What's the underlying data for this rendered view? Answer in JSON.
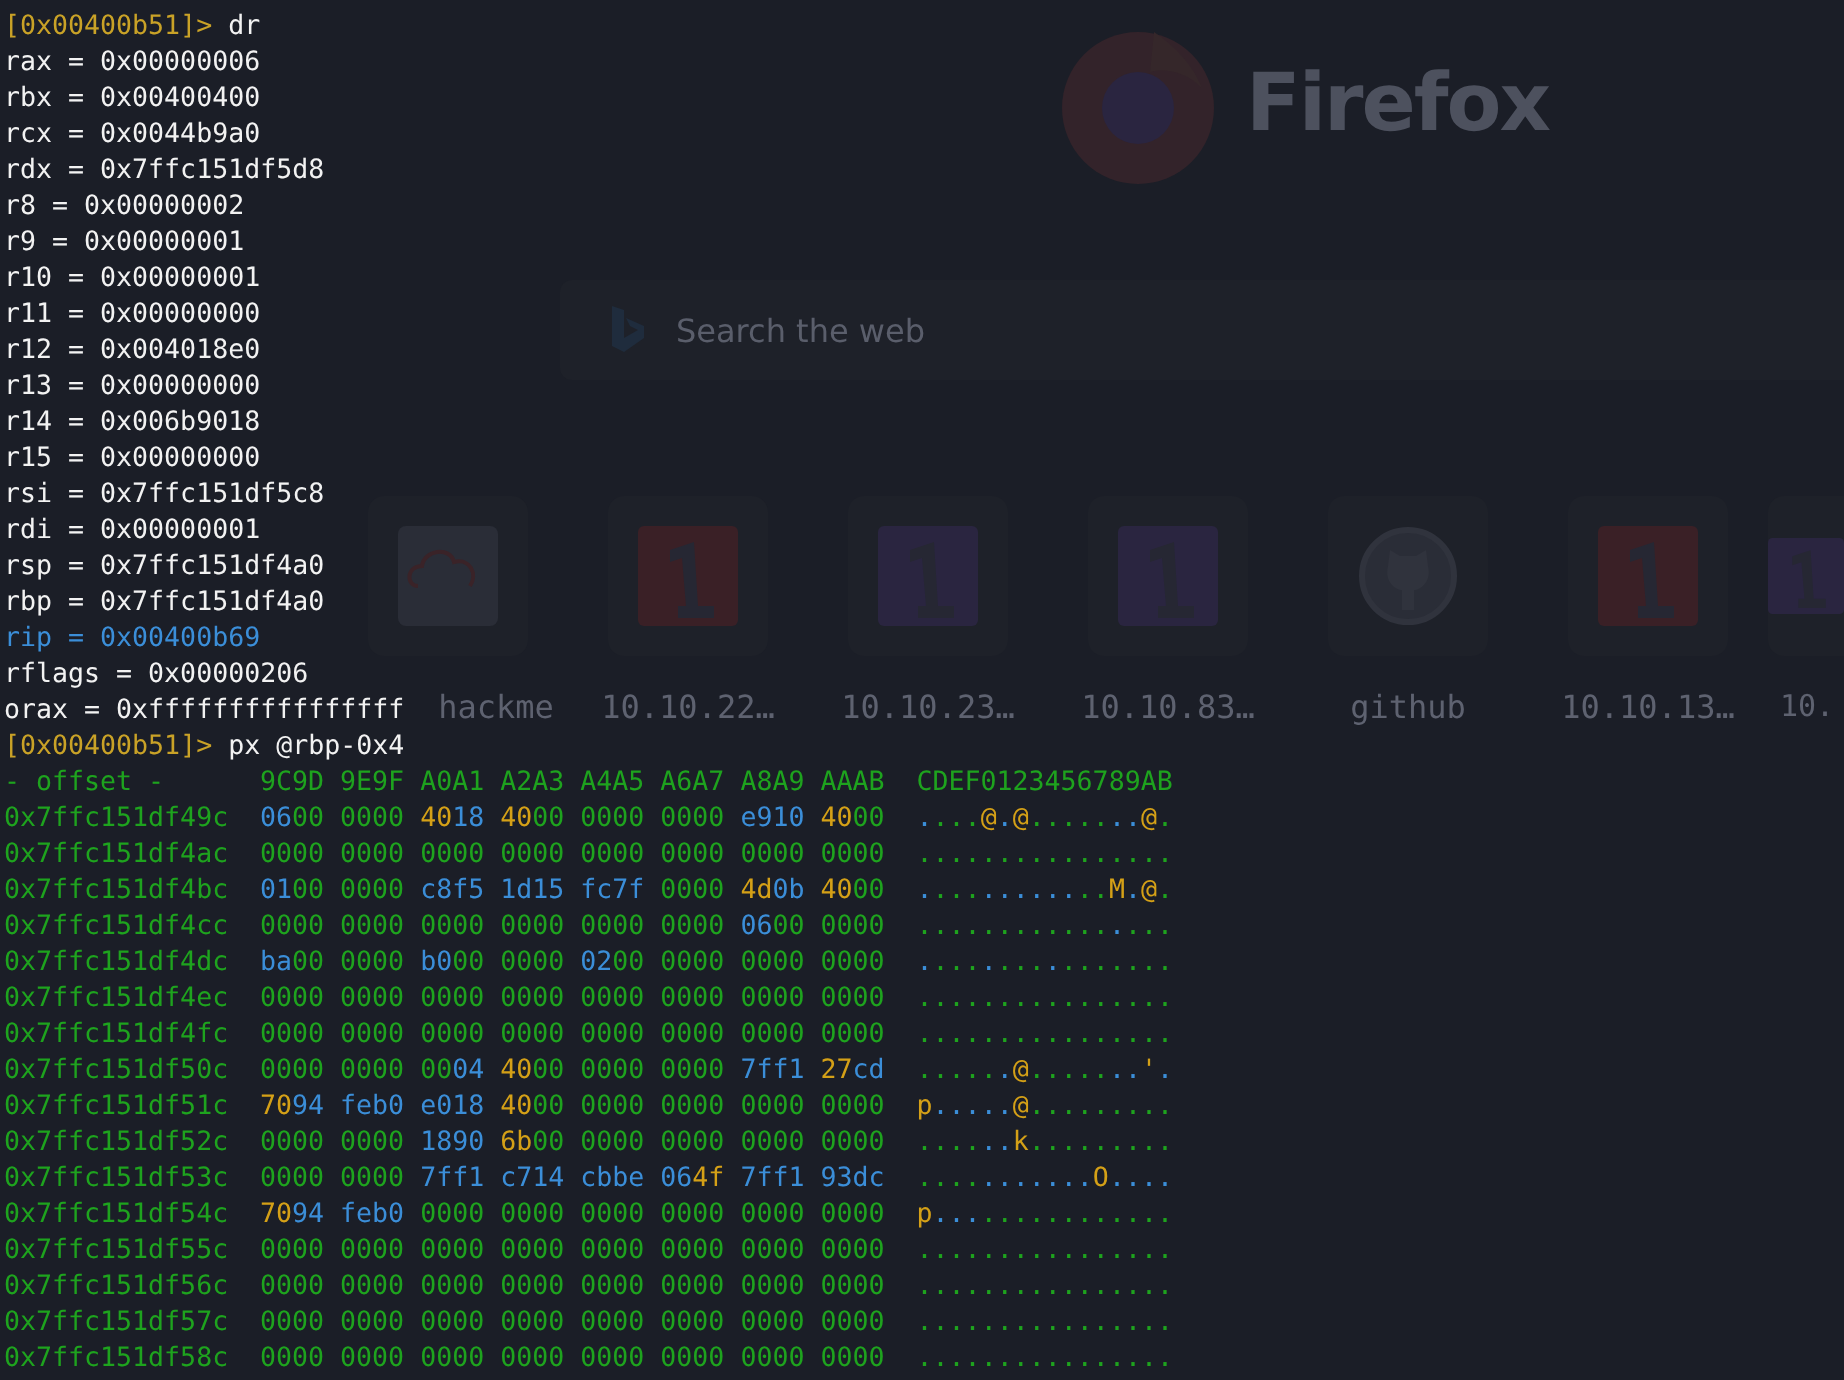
{
  "background_browser": {
    "brand": "Firefox",
    "search_placeholder": "Search the web",
    "shortcuts": [
      {
        "label": "hackme",
        "kind": "cloud",
        "color": "#2a2d37"
      },
      {
        "label": "10.10.22…",
        "kind": "numeral",
        "color": "#3a2026"
      },
      {
        "label": "10.10.23…",
        "kind": "numeral",
        "color": "#2a2540"
      },
      {
        "label": "10.10.83…",
        "kind": "numeral",
        "color": "#2a2540"
      },
      {
        "label": "github",
        "kind": "github",
        "color": "#2a2d37"
      },
      {
        "label": "10.10.13…",
        "kind": "numeral",
        "color": "#3a2026"
      },
      {
        "label": "10.",
        "kind": "numeral",
        "color": "#2a2540"
      }
    ]
  },
  "terminal": {
    "lines": [
      {
        "kind": "prompt",
        "address": "[0x00400b51]>",
        "command": "dr"
      },
      {
        "kind": "register",
        "text": "rax = 0x00000006",
        "changed": false
      },
      {
        "kind": "register",
        "text": "rbx = 0x00400400",
        "changed": false
      },
      {
        "kind": "register",
        "text": "rcx = 0x0044b9a0",
        "changed": false
      },
      {
        "kind": "register",
        "text": "rdx = 0x7ffc151df5d8",
        "changed": false
      },
      {
        "kind": "register",
        "text": "r8 = 0x00000002",
        "changed": false
      },
      {
        "kind": "register",
        "text": "r9 = 0x00000001",
        "changed": false
      },
      {
        "kind": "register",
        "text": "r10 = 0x00000001",
        "changed": false
      },
      {
        "kind": "register",
        "text": "r11 = 0x00000000",
        "changed": false
      },
      {
        "kind": "register",
        "text": "r12 = 0x004018e0",
        "changed": false
      },
      {
        "kind": "register",
        "text": "r13 = 0x00000000",
        "changed": false
      },
      {
        "kind": "register",
        "text": "r14 = 0x006b9018",
        "changed": false
      },
      {
        "kind": "register",
        "text": "r15 = 0x00000000",
        "changed": false
      },
      {
        "kind": "register",
        "text": "rsi = 0x7ffc151df5c8",
        "changed": false
      },
      {
        "kind": "register",
        "text": "rdi = 0x00000001",
        "changed": false
      },
      {
        "kind": "register",
        "text": "rsp = 0x7ffc151df4a0",
        "changed": false
      },
      {
        "kind": "register",
        "text": "rbp = 0x7ffc151df4a0",
        "changed": false
      },
      {
        "kind": "register",
        "text": "rip = 0x00400b69",
        "changed": true
      },
      {
        "kind": "register",
        "text": "rflags = 0x00000206",
        "changed": false
      },
      {
        "kind": "register",
        "text": "orax = 0xffffffffffffffff",
        "changed": false
      },
      {
        "kind": "prompt",
        "address": "[0x00400b51]>",
        "command": "px @rbp-0x4"
      },
      {
        "kind": "hex_header",
        "offset": "- offset -",
        "columns": [
          "9C9D",
          "9E9F",
          "A0A1",
          "A2A3",
          "A4A5",
          "A6A7",
          "A8A9",
          "AAAB"
        ],
        "ascii": "CDEF0123456789AB"
      },
      {
        "kind": "hex_row",
        "offset": "0x7ffc151df49c",
        "words": [
          "0600",
          "0000",
          "4018",
          "4000",
          "0000",
          "0000",
          "e910",
          "4000"
        ],
        "ascii": "....@.@.......@."
      },
      {
        "kind": "hex_row",
        "offset": "0x7ffc151df4ac",
        "words": [
          "0000",
          "0000",
          "0000",
          "0000",
          "0000",
          "0000",
          "0000",
          "0000"
        ],
        "ascii": "................"
      },
      {
        "kind": "hex_row",
        "offset": "0x7ffc151df4bc",
        "words": [
          "0100",
          "0000",
          "c8f5",
          "1d15",
          "fc7f",
          "0000",
          "4d0b",
          "4000"
        ],
        "ascii": "............M.@."
      },
      {
        "kind": "hex_row",
        "offset": "0x7ffc151df4cc",
        "words": [
          "0000",
          "0000",
          "0000",
          "0000",
          "0000",
          "0000",
          "0600",
          "0000"
        ],
        "ascii": "................"
      },
      {
        "kind": "hex_row",
        "offset": "0x7ffc151df4dc",
        "words": [
          "ba00",
          "0000",
          "b000",
          "0000",
          "0200",
          "0000",
          "0000",
          "0000"
        ],
        "ascii": "................"
      },
      {
        "kind": "hex_row",
        "offset": "0x7ffc151df4ec",
        "words": [
          "0000",
          "0000",
          "0000",
          "0000",
          "0000",
          "0000",
          "0000",
          "0000"
        ],
        "ascii": "................"
      },
      {
        "kind": "hex_row",
        "offset": "0x7ffc151df4fc",
        "words": [
          "0000",
          "0000",
          "0000",
          "0000",
          "0000",
          "0000",
          "0000",
          "0000"
        ],
        "ascii": "................"
      },
      {
        "kind": "hex_row",
        "offset": "0x7ffc151df50c",
        "words": [
          "0000",
          "0000",
          "0004",
          "4000",
          "0000",
          "0000",
          "7ff1",
          "27cd"
        ],
        "ascii": "......@.......'."
      },
      {
        "kind": "hex_row",
        "offset": "0x7ffc151df51c",
        "words": [
          "7094",
          "feb0",
          "e018",
          "4000",
          "0000",
          "0000",
          "0000",
          "0000"
        ],
        "ascii": "p.....@........."
      },
      {
        "kind": "hex_row",
        "offset": "0x7ffc151df52c",
        "words": [
          "0000",
          "0000",
          "1890",
          "6b00",
          "0000",
          "0000",
          "0000",
          "0000"
        ],
        "ascii": "......k........."
      },
      {
        "kind": "hex_row",
        "offset": "0x7ffc151df53c",
        "words": [
          "0000",
          "0000",
          "7ff1",
          "c714",
          "cbbe",
          "064f",
          "7ff1",
          "93dc"
        ],
        "ascii": "...........O...."
      },
      {
        "kind": "hex_row",
        "offset": "0x7ffc151df54c",
        "words": [
          "7094",
          "feb0",
          "0000",
          "0000",
          "0000",
          "0000",
          "0000",
          "0000"
        ],
        "ascii": "p..............."
      },
      {
        "kind": "hex_row",
        "offset": "0x7ffc151df55c",
        "words": [
          "0000",
          "0000",
          "0000",
          "0000",
          "0000",
          "0000",
          "0000",
          "0000"
        ],
        "ascii": "................"
      },
      {
        "kind": "hex_row",
        "offset": "0x7ffc151df56c",
        "words": [
          "0000",
          "0000",
          "0000",
          "0000",
          "0000",
          "0000",
          "0000",
          "0000"
        ],
        "ascii": "................"
      },
      {
        "kind": "hex_row",
        "offset": "0x7ffc151df57c",
        "words": [
          "0000",
          "0000",
          "0000",
          "0000",
          "0000",
          "0000",
          "0000",
          "0000"
        ],
        "ascii": "................"
      },
      {
        "kind": "hex_row",
        "offset": "0x7ffc151df58c",
        "words": [
          "0000",
          "0000",
          "0000",
          "0000",
          "0000",
          "0000",
          "0000",
          "0000"
        ],
        "ascii": "................"
      }
    ]
  }
}
